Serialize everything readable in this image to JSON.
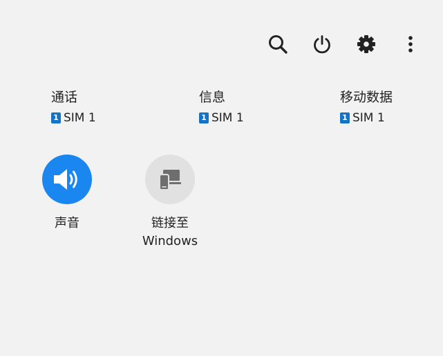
{
  "toolbar": {
    "icons": [
      "search-icon",
      "power-icon",
      "settings-gear-icon",
      "more-vertical-icon"
    ]
  },
  "sim_shortcuts": [
    {
      "title": "通话",
      "sim_badge": "1",
      "sim_label": "SIM 1"
    },
    {
      "title": "信息",
      "sim_badge": "1",
      "sim_label": "SIM 1"
    },
    {
      "title": "移动数据",
      "sim_badge": "1",
      "sim_label": "SIM 1"
    }
  ],
  "tiles": [
    {
      "label": "声音",
      "icon": "volume-icon",
      "active": true
    },
    {
      "label_line1": "链接至",
      "label_line2": "Windows",
      "icon": "link-to-windows-icon",
      "active": false
    }
  ],
  "colors": {
    "background": "#f2f2f2",
    "accent": "#1a86f0",
    "sim_badge": "#1573c7",
    "inactive_tile": "#e1e1e1",
    "icon_dark": "#222222",
    "inactive_icon": "#6e6e6e"
  }
}
